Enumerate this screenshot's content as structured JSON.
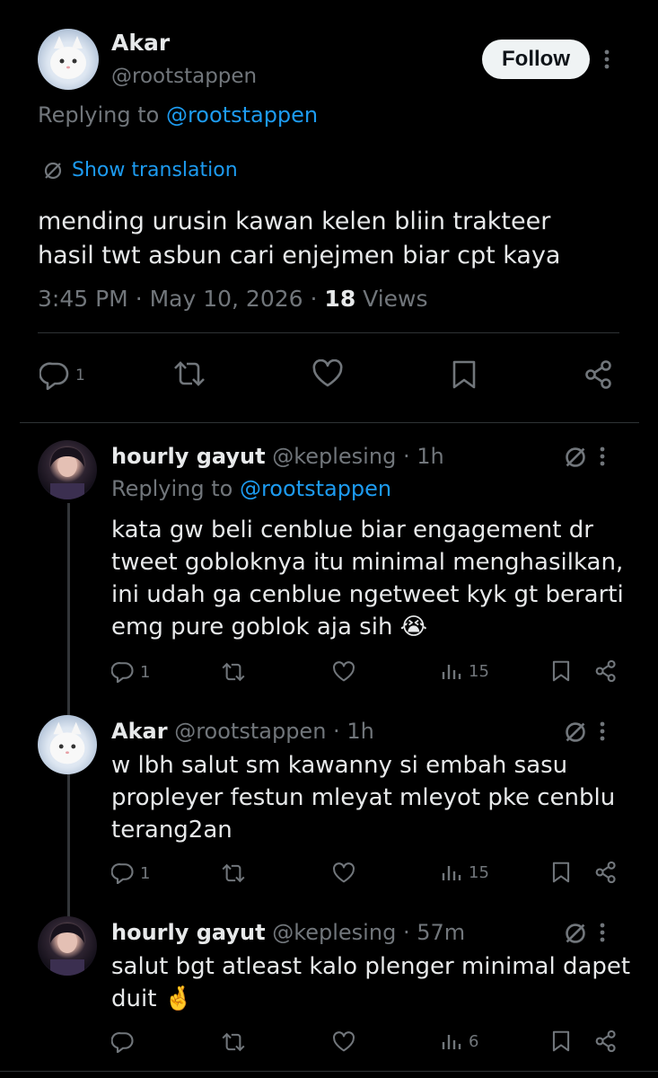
{
  "main_tweet": {
    "author_name": "Akar",
    "handle": "@rootstappen",
    "follow_label": "Follow",
    "replying_prefix": "Replying to",
    "replying_to": "@rootstappen",
    "translation_label": "Show translation",
    "text_line1": "mending urusin kawan kelen bliin trakteer",
    "text_line2": "hasil twt asbun cari enjejmen biar cpt kaya",
    "time": "3:45 PM",
    "date": "May 10, 2026",
    "views_count": "18",
    "views_label": "Views",
    "reply_count": "1"
  },
  "replies": [
    {
      "name": "hourly gayut",
      "handle": "@keplesing",
      "time": "1h",
      "replying_prefix": "Replying to",
      "replying_to": "@rootstappen",
      "line1": "kata gw beli cenblue biar engagement dr",
      "line2": "tweet gobloknya itu minimal menghasilkan,",
      "line3": "ini udah ga cenblue ngetweet kyk gt berarti",
      "line4": "emg pure goblok aja sih 😭",
      "reply_count": "1",
      "view_count": "15"
    },
    {
      "name": "Akar",
      "handle": "@rootstappen",
      "time": "1h",
      "line1": "w lbh salut sm kawanny si embah sasu",
      "line2": "propleyer festun mleyat mleyot pke cenblu",
      "line3": "terang2an",
      "reply_count": "1",
      "view_count": "15"
    },
    {
      "name": "hourly gayut",
      "handle": "@keplesing",
      "time": "57m",
      "line1": "salut bgt atleast kalo plenger minimal dapet",
      "line2": "duit 🤞",
      "view_count": "6"
    }
  ],
  "icons": {
    "reply": "reply-icon",
    "retweet": "retweet-icon",
    "like": "heart-icon",
    "bookmark": "bookmark-icon",
    "share": "share-icon",
    "views": "views-icon",
    "more": "more-icon",
    "translate": "translate-icon"
  },
  "colors": {
    "background": "#000000",
    "text": "#e7e9ea",
    "muted": "#71767b",
    "link": "#1d9bf0",
    "follow_bg": "#eff3f4"
  }
}
